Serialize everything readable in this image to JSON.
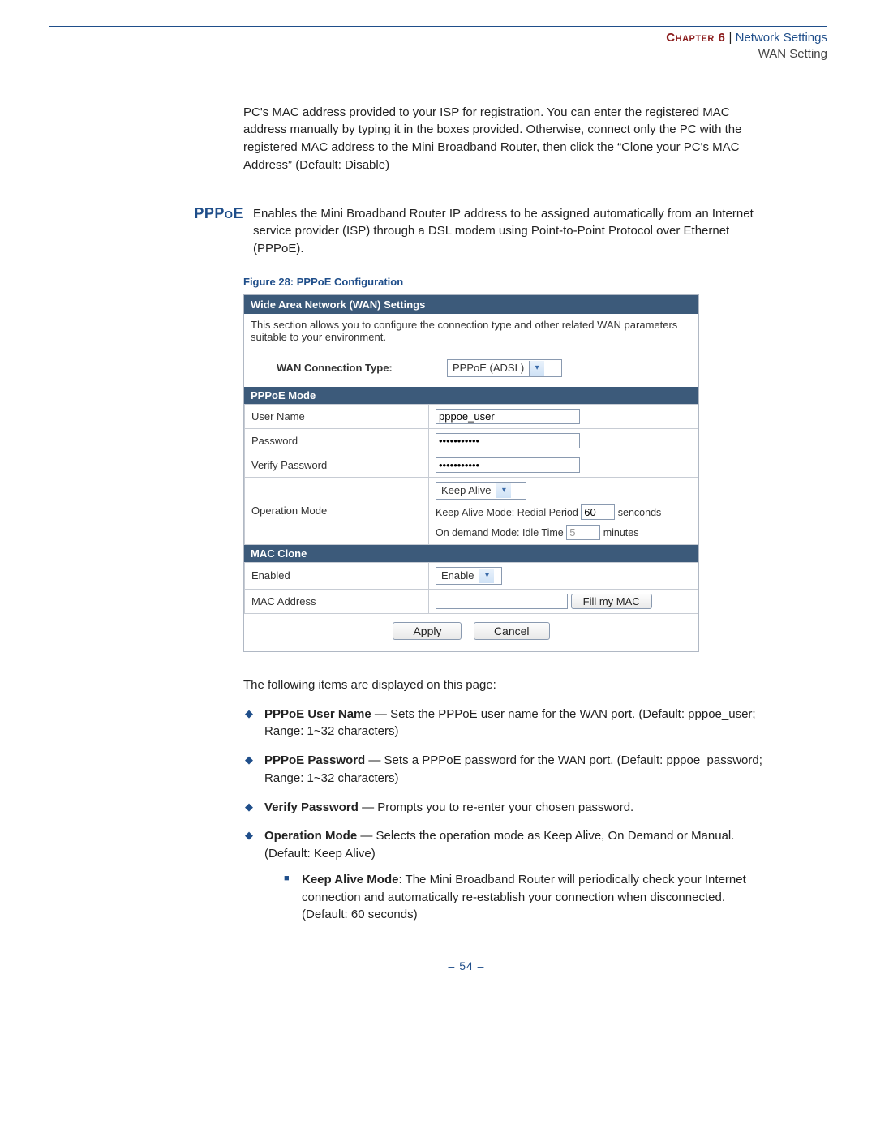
{
  "header": {
    "chapter": "Chapter 6",
    "sep": "  |  ",
    "title1": "Network Settings",
    "title2": "WAN Setting"
  },
  "intro_para": "PC's MAC address provided to your ISP for registration. You can enter the registered MAC address manually by typing it in the boxes provided. Otherwise, connect only the PC with the registered MAC address to the Mini Broadband Router, then click the “Clone your PC's MAC Address” (Default: Disable)",
  "pppoe": {
    "label": "PPPoE",
    "body": "Enables the Mini Broadband Router IP address to be assigned automatically from an Internet service provider (ISP) through a DSL modem using Point-to-Point Protocol over Ethernet (PPPoE)."
  },
  "figure_caption": "Figure 28:  PPPoE Configuration",
  "panel": {
    "title": "Wide Area Network (WAN) Settings",
    "desc": "This section allows you to configure the connection type and other related WAN parameters suitable to your environment.",
    "conn_label": "WAN Connection Type:",
    "conn_value": "PPPoE (ADSL)",
    "pppoe_mode_header": "PPPoE Mode",
    "rows": {
      "username_label": "User Name",
      "username_value": "pppoe_user",
      "password_label": "Password",
      "password_value": "•••••••••••",
      "verify_label": "Verify Password",
      "verify_value": "•••••••••••",
      "opmode_label": "Operation Mode",
      "opmode_value": "Keep Alive",
      "keepalive_text_a": "Keep Alive Mode: Redial Period",
      "keepalive_val": "60",
      "keepalive_text_b": "senconds",
      "ondemand_text_a": "On demand Mode: Idle Time",
      "ondemand_val": "5",
      "ondemand_text_b": "minutes"
    },
    "mac_clone_header": "MAC Clone",
    "mac": {
      "enabled_label": "Enabled",
      "enabled_value": "Enable",
      "addr_label": "MAC Address",
      "addr_value": "",
      "fill_btn": "Fill my MAC"
    },
    "apply": "Apply",
    "cancel": "Cancel"
  },
  "following_text": "The following items are displayed on this page:",
  "bullets": [
    {
      "b": "PPPoE User Name",
      "rest": " — Sets the PPPoE user name for the WAN port. (Default: pppoe_user; Range: 1~32 characters)"
    },
    {
      "b": "PPPoE Password",
      "rest": " — Sets a PPPoE password for the WAN port. (Default: pppoe_password; Range: 1~32 characters)"
    },
    {
      "b": "Verify Password",
      "rest": " — Prompts you to re-enter your chosen password."
    },
    {
      "b": "Operation Mode",
      "rest": " — Selects the operation mode as Keep Alive, On Demand or Manual. (Default: Keep Alive)"
    }
  ],
  "sub_bullet": {
    "b": "Keep Alive Mode",
    "rest": ": The Mini Broadband Router will periodically check your Internet connection and automatically re-establish your connection when disconnected. (Default: 60 seconds)"
  },
  "page_number": "–  54  –"
}
